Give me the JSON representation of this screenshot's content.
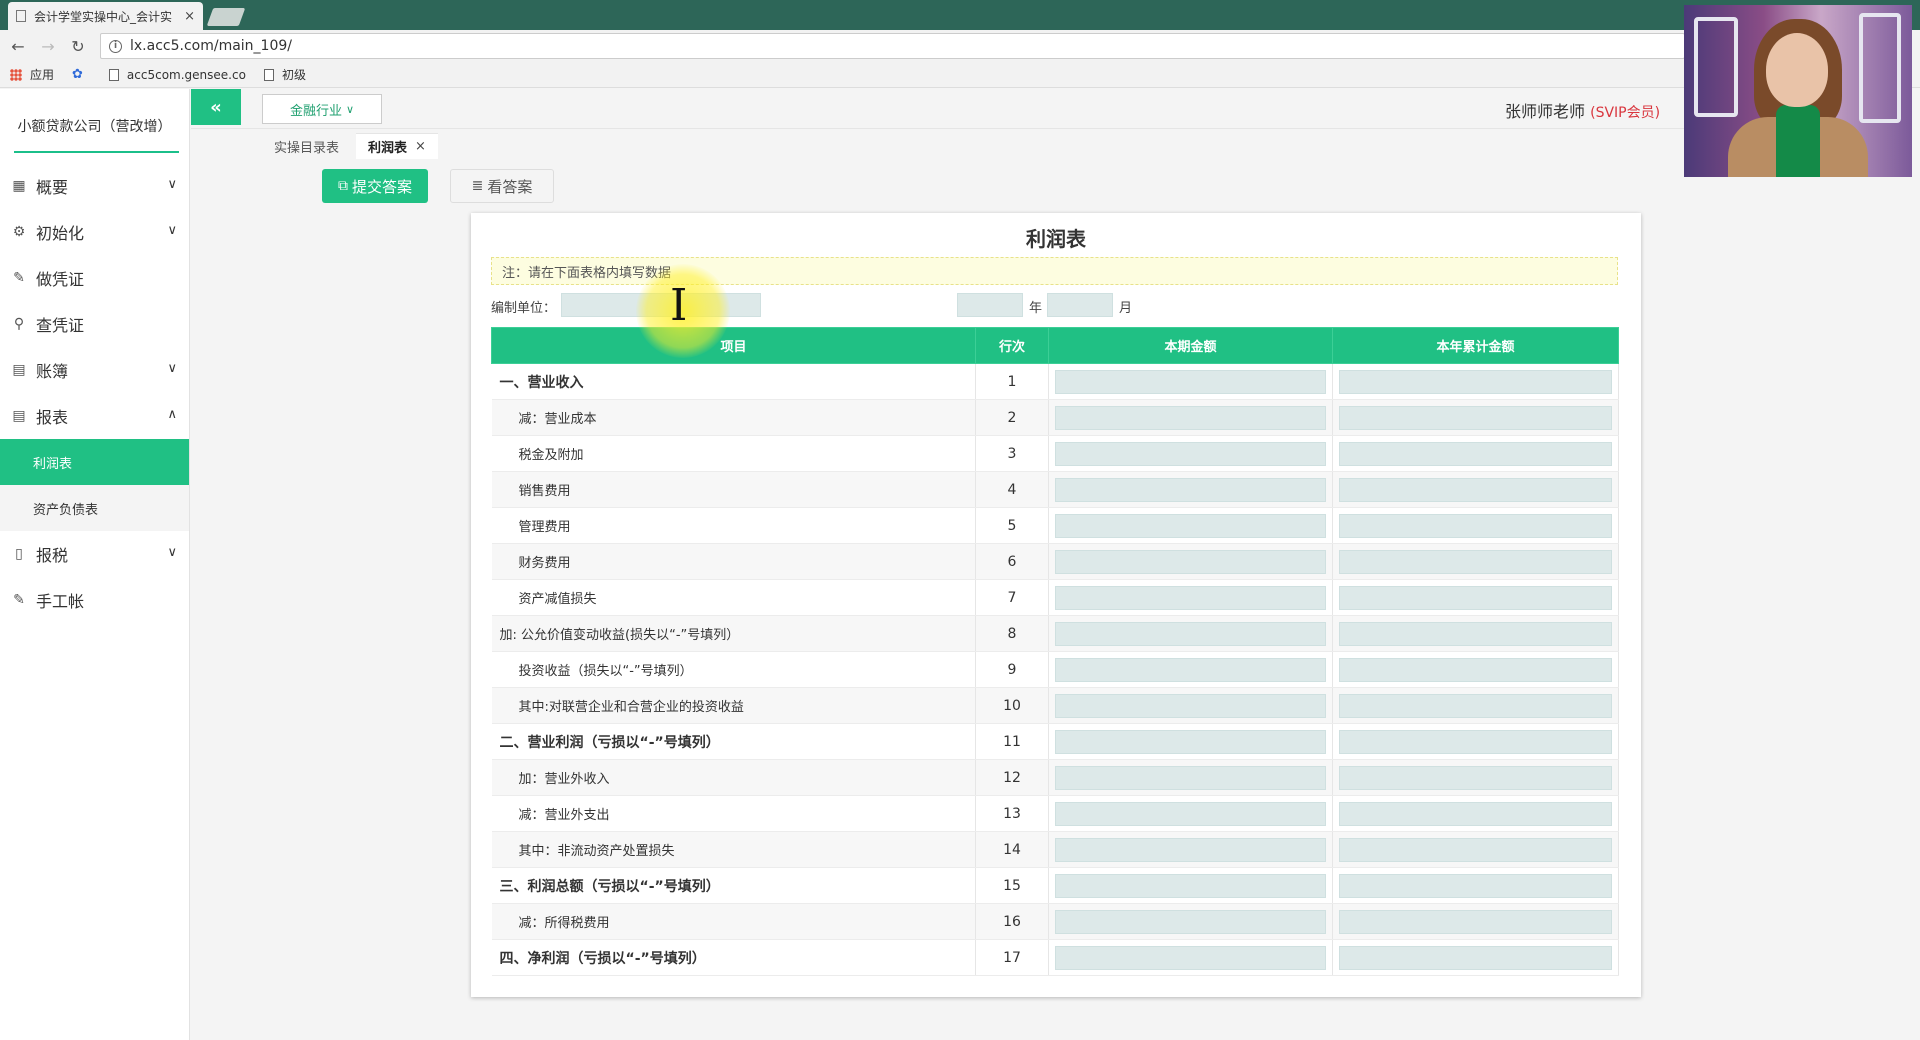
{
  "browser": {
    "tab_title": "会计学堂实操中心_会计实",
    "tab_close": "×",
    "url": "lx.acc5.com/main_109/",
    "bookmarks": [
      "应用",
      "acc5com.gensee.co",
      "初级"
    ]
  },
  "app": {
    "company": "小额贷款公司（营改增）",
    "industry": "金融行业",
    "user_name": "张师师老师",
    "user_level": "(SVIP会员)",
    "tabs": [
      "实操目录表",
      "利润表"
    ],
    "tab_close": "×",
    "submit_label": "提交答案",
    "answer_label": "看答案"
  },
  "sidebar": {
    "items": [
      {
        "label": "概要",
        "icon": "grid-icon"
      },
      {
        "label": "初始化",
        "icon": "gear-icon"
      },
      {
        "label": "做凭证",
        "icon": "pen-icon"
      },
      {
        "label": "查凭证",
        "icon": "search-icon"
      },
      {
        "label": "账簿",
        "icon": "book-icon"
      },
      {
        "label": "报表",
        "icon": "report-icon"
      },
      {
        "label": "报税",
        "icon": "file-icon"
      },
      {
        "label": "手工帐",
        "icon": "pen-icon"
      }
    ],
    "sub_items": [
      "利润表",
      "资产负债表"
    ]
  },
  "report": {
    "title": "利润表",
    "note": "注：请在下面表格内填写数据",
    "unit_label": "编制单位：",
    "year_label": "年",
    "month_label": "月",
    "headers": [
      "项目",
      "行次",
      "本期金额",
      "本年累计金额"
    ],
    "rows": [
      {
        "item": "一、营业收入",
        "no": "1"
      },
      {
        "item": "减：营业成本",
        "no": "2"
      },
      {
        "item": "税金及附加",
        "no": "3"
      },
      {
        "item": "销售费用",
        "no": "4"
      },
      {
        "item": "管理费用",
        "no": "5"
      },
      {
        "item": "财务费用",
        "no": "6"
      },
      {
        "item": "资产减值损失",
        "no": "7"
      },
      {
        "item": "加: 公允价值变动收益(损失以“-”号填列）",
        "no": "8"
      },
      {
        "item": "投资收益（损失以“-”号填列）",
        "no": "9"
      },
      {
        "item": "其中:对联营企业和合营企业的投资收益",
        "no": "10"
      },
      {
        "item": "二、营业利润（亏损以“-”号填列）",
        "no": "11"
      },
      {
        "item": "加：营业外收入",
        "no": "12"
      },
      {
        "item": "减：营业外支出",
        "no": "13"
      },
      {
        "item": "其中：非流动资产处置损失",
        "no": "14"
      },
      {
        "item": "三、利润总额（亏损以“-”号填列）",
        "no": "15"
      },
      {
        "item": "减：所得税费用",
        "no": "16"
      },
      {
        "item": "四、净利润（亏损以“-”号填列）",
        "no": "17"
      }
    ]
  },
  "colors": {
    "accent": "#20c084",
    "vip": "#d9363e",
    "input_bg": "#dde9e9",
    "note_bg": "#fdfde0",
    "browser_tabstrip": "#2d6658"
  }
}
